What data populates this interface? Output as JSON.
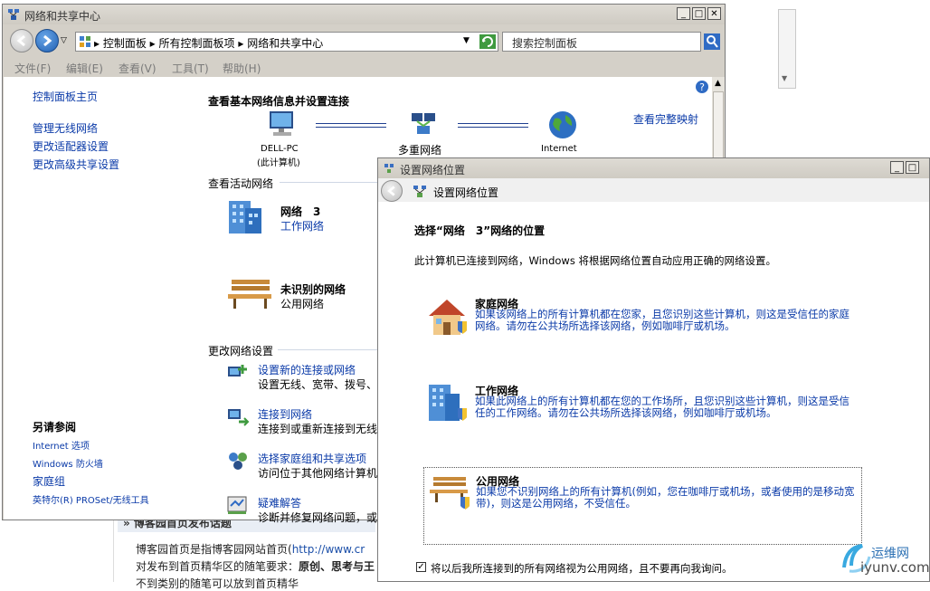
{
  "background": {
    "heading": "» 博客园首页发布话题",
    "line1_prefix": "博客园首页是指博客园网站首页(",
    "line1_link": "http://www.cr",
    "line2_prefix": "对发布到首页精华区的随笔要求：",
    "line2_bold": "原创、思考与王",
    "line3": "不到类别的随笔可以放到首页精华"
  },
  "window_main": {
    "title": "网络和共享中心",
    "controls": {
      "minimize": "_",
      "maximize": "□",
      "close": "✕"
    },
    "breadcrumb": [
      "控制面板",
      "所有控制面板项",
      "网络和共享中心"
    ],
    "search_placeholder": "搜索控制面板",
    "menu": [
      "文件(F)",
      "编辑(E)",
      "查看(V)",
      "工具(T)",
      "帮助(H)"
    ],
    "sidebar": {
      "home": "控制面板主页",
      "links": [
        "管理无线网络",
        "更改适配器设置",
        "更改高级共享设置"
      ],
      "see_also_title": "另请参阅",
      "see_also": [
        "Internet 选项",
        "Windows 防火墙",
        "家庭组",
        "英特尔(R) PROSet/无线工具"
      ]
    },
    "main": {
      "heading": "查看基本网络信息并设置连接",
      "full_map": "查看完整映射",
      "nodes": [
        {
          "name": "DELL-PC",
          "sub": "(此计算机)"
        },
        {
          "name": "多重网络",
          "sub": ""
        },
        {
          "name": "Internet",
          "sub": ""
        }
      ],
      "active_title": "查看活动网络",
      "networks": [
        {
          "name": "网络　3",
          "type": "工作网络"
        },
        {
          "name": "未识别的网络",
          "type": "公用网络"
        }
      ],
      "change_title": "更改网络设置",
      "tasks": [
        {
          "title": "设置新的连接或网络",
          "desc": "设置无线、宽带、拨号、"
        },
        {
          "title": "连接到网络",
          "desc": "连接到或重新连接到无线"
        },
        {
          "title": "选择家庭组和共享选项",
          "desc": "访问位于其他网络计算机"
        },
        {
          "title": "疑难解答",
          "desc": "诊断并修复网络问题，或"
        }
      ]
    }
  },
  "window_dialog": {
    "title": "设置网络位置",
    "header": "设置网络位置",
    "controls": {
      "minimize": "_",
      "maximize": "□"
    },
    "question": "选择“网络　3”网络的位置",
    "intro": "此计算机已连接到网络，Windows 将根据网络位置自动应用正确的网络设置。",
    "options": [
      {
        "title": "家庭网络",
        "desc": "如果该网络上的所有计算机都在您家，且您识别这些计算机，则这是受信任的家庭网络。请勿在公共场所选择该网络，例如咖啡厅或机场。",
        "selected": false
      },
      {
        "title": "工作网络",
        "desc": "如果此网络上的所有计算机都在您的工作场所，且您识别这些计算机，则这是受信任的工作网络。请勿在公共场所选择该网络，例如咖啡厅或机场。",
        "selected": false
      },
      {
        "title": "公用网络",
        "desc": "如果您不识别网络上的所有计算机(例如，您在咖啡厅或机场，或者使用的是移动宽带)，则这是公用网络，不受信任。",
        "selected": true
      }
    ],
    "checkbox_label": "将以后我所连接到的所有网络视为公用网络，且不要再向我询问。",
    "checkbox_checked": true
  },
  "watermark": {
    "cn": "运维网",
    "en": "iyunv.com"
  }
}
